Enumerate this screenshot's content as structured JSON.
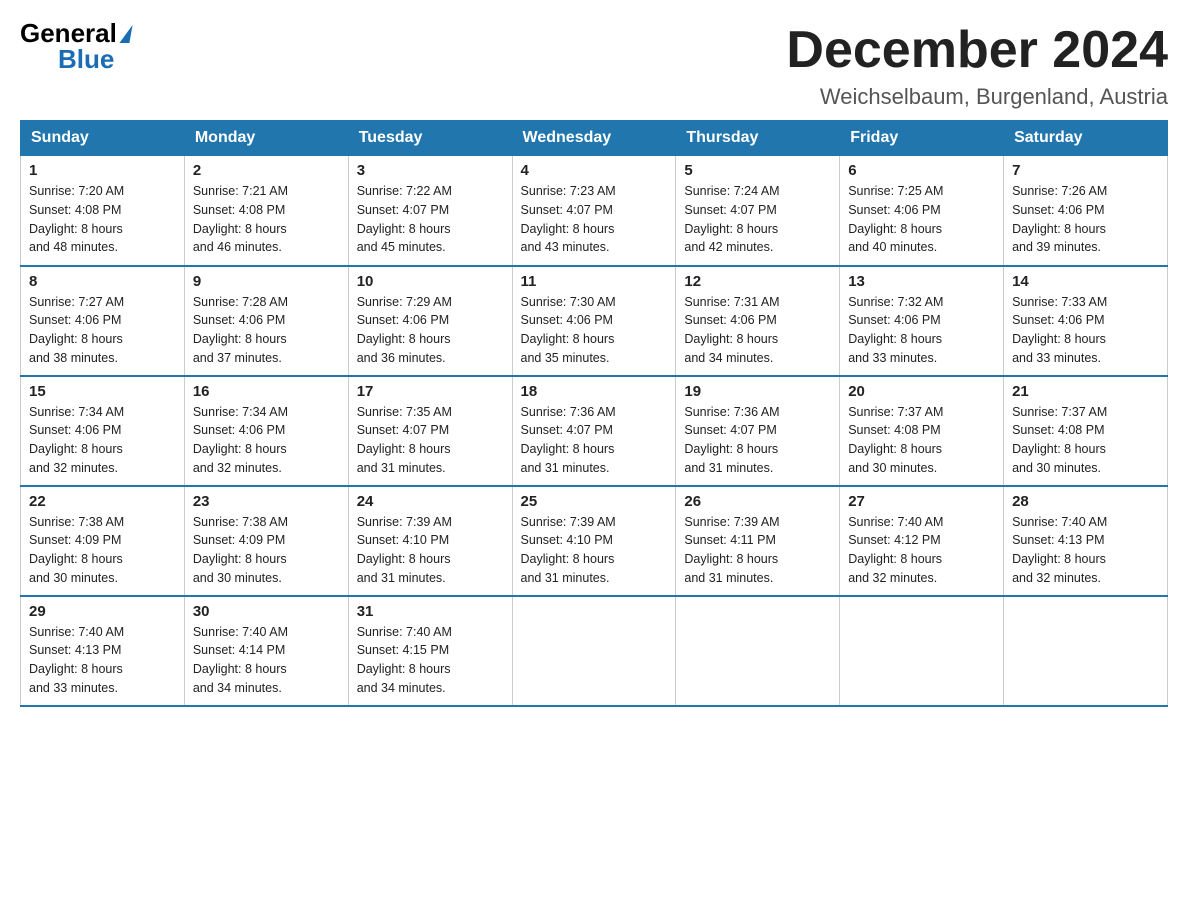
{
  "header": {
    "logo_general": "General",
    "logo_blue": "Blue",
    "month_title": "December 2024",
    "location": "Weichselbaum, Burgenland, Austria"
  },
  "days_of_week": [
    "Sunday",
    "Monday",
    "Tuesday",
    "Wednesday",
    "Thursday",
    "Friday",
    "Saturday"
  ],
  "weeks": [
    [
      {
        "day": "1",
        "sunrise": "7:20 AM",
        "sunset": "4:08 PM",
        "daylight": "8 hours and 48 minutes."
      },
      {
        "day": "2",
        "sunrise": "7:21 AM",
        "sunset": "4:08 PM",
        "daylight": "8 hours and 46 minutes."
      },
      {
        "day": "3",
        "sunrise": "7:22 AM",
        "sunset": "4:07 PM",
        "daylight": "8 hours and 45 minutes."
      },
      {
        "day": "4",
        "sunrise": "7:23 AM",
        "sunset": "4:07 PM",
        "daylight": "8 hours and 43 minutes."
      },
      {
        "day": "5",
        "sunrise": "7:24 AM",
        "sunset": "4:07 PM",
        "daylight": "8 hours and 42 minutes."
      },
      {
        "day": "6",
        "sunrise": "7:25 AM",
        "sunset": "4:06 PM",
        "daylight": "8 hours and 40 minutes."
      },
      {
        "day": "7",
        "sunrise": "7:26 AM",
        "sunset": "4:06 PM",
        "daylight": "8 hours and 39 minutes."
      }
    ],
    [
      {
        "day": "8",
        "sunrise": "7:27 AM",
        "sunset": "4:06 PM",
        "daylight": "8 hours and 38 minutes."
      },
      {
        "day": "9",
        "sunrise": "7:28 AM",
        "sunset": "4:06 PM",
        "daylight": "8 hours and 37 minutes."
      },
      {
        "day": "10",
        "sunrise": "7:29 AM",
        "sunset": "4:06 PM",
        "daylight": "8 hours and 36 minutes."
      },
      {
        "day": "11",
        "sunrise": "7:30 AM",
        "sunset": "4:06 PM",
        "daylight": "8 hours and 35 minutes."
      },
      {
        "day": "12",
        "sunrise": "7:31 AM",
        "sunset": "4:06 PM",
        "daylight": "8 hours and 34 minutes."
      },
      {
        "day": "13",
        "sunrise": "7:32 AM",
        "sunset": "4:06 PM",
        "daylight": "8 hours and 33 minutes."
      },
      {
        "day": "14",
        "sunrise": "7:33 AM",
        "sunset": "4:06 PM",
        "daylight": "8 hours and 33 minutes."
      }
    ],
    [
      {
        "day": "15",
        "sunrise": "7:34 AM",
        "sunset": "4:06 PM",
        "daylight": "8 hours and 32 minutes."
      },
      {
        "day": "16",
        "sunrise": "7:34 AM",
        "sunset": "4:06 PM",
        "daylight": "8 hours and 32 minutes."
      },
      {
        "day": "17",
        "sunrise": "7:35 AM",
        "sunset": "4:07 PM",
        "daylight": "8 hours and 31 minutes."
      },
      {
        "day": "18",
        "sunrise": "7:36 AM",
        "sunset": "4:07 PM",
        "daylight": "8 hours and 31 minutes."
      },
      {
        "day": "19",
        "sunrise": "7:36 AM",
        "sunset": "4:07 PM",
        "daylight": "8 hours and 31 minutes."
      },
      {
        "day": "20",
        "sunrise": "7:37 AM",
        "sunset": "4:08 PM",
        "daylight": "8 hours and 30 minutes."
      },
      {
        "day": "21",
        "sunrise": "7:37 AM",
        "sunset": "4:08 PM",
        "daylight": "8 hours and 30 minutes."
      }
    ],
    [
      {
        "day": "22",
        "sunrise": "7:38 AM",
        "sunset": "4:09 PM",
        "daylight": "8 hours and 30 minutes."
      },
      {
        "day": "23",
        "sunrise": "7:38 AM",
        "sunset": "4:09 PM",
        "daylight": "8 hours and 30 minutes."
      },
      {
        "day": "24",
        "sunrise": "7:39 AM",
        "sunset": "4:10 PM",
        "daylight": "8 hours and 31 minutes."
      },
      {
        "day": "25",
        "sunrise": "7:39 AM",
        "sunset": "4:10 PM",
        "daylight": "8 hours and 31 minutes."
      },
      {
        "day": "26",
        "sunrise": "7:39 AM",
        "sunset": "4:11 PM",
        "daylight": "8 hours and 31 minutes."
      },
      {
        "day": "27",
        "sunrise": "7:40 AM",
        "sunset": "4:12 PM",
        "daylight": "8 hours and 32 minutes."
      },
      {
        "day": "28",
        "sunrise": "7:40 AM",
        "sunset": "4:13 PM",
        "daylight": "8 hours and 32 minutes."
      }
    ],
    [
      {
        "day": "29",
        "sunrise": "7:40 AM",
        "sunset": "4:13 PM",
        "daylight": "8 hours and 33 minutes."
      },
      {
        "day": "30",
        "sunrise": "7:40 AM",
        "sunset": "4:14 PM",
        "daylight": "8 hours and 34 minutes."
      },
      {
        "day": "31",
        "sunrise": "7:40 AM",
        "sunset": "4:15 PM",
        "daylight": "8 hours and 34 minutes."
      },
      null,
      null,
      null,
      null
    ]
  ],
  "labels": {
    "sunrise": "Sunrise:",
    "sunset": "Sunset:",
    "daylight": "Daylight:"
  }
}
